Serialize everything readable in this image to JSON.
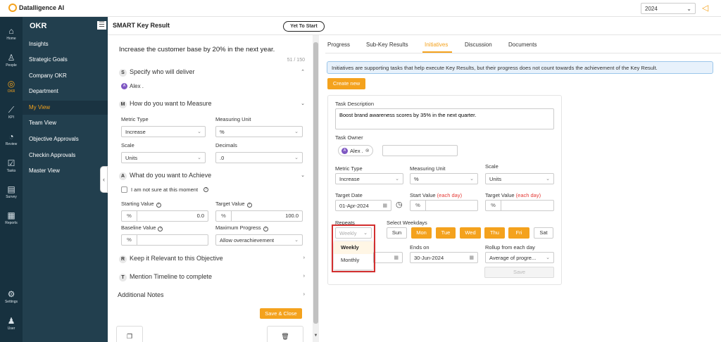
{
  "app": {
    "logo_text": "Datalligence AI"
  },
  "topbar": {
    "year": "2024"
  },
  "rail": [
    {
      "label": "Home",
      "icon": "home-icon"
    },
    {
      "label": "People",
      "icon": "people-icon"
    },
    {
      "label": "OKR",
      "icon": "okr-icon"
    },
    {
      "label": "KPI",
      "icon": "kpi-icon"
    },
    {
      "label": "Review",
      "icon": "review-icon"
    },
    {
      "label": "Tasks",
      "icon": "tasks-icon"
    },
    {
      "label": "Survey",
      "icon": "survey-icon"
    },
    {
      "label": "Reports",
      "icon": "reports-icon"
    },
    {
      "label": "Settings",
      "icon": "settings-icon"
    },
    {
      "label": "User",
      "icon": "user-icon"
    }
  ],
  "nav": {
    "title": "OKR",
    "items": [
      {
        "label": "Insights"
      },
      {
        "label": "Strategic Goals"
      },
      {
        "label": "Company OKR"
      },
      {
        "label": "Department"
      },
      {
        "label": "My View"
      },
      {
        "label": "Team View"
      },
      {
        "label": "Objective Approvals"
      },
      {
        "label": "Checkin Approvals"
      },
      {
        "label": "Master View"
      }
    ]
  },
  "kr": {
    "header_title": "SMART Key Result",
    "status": "Yet To Start",
    "title": "Increase the customer base by 20% in the next year.",
    "char_count": "51 / 150",
    "sections": {
      "specify": {
        "letter": "S",
        "title": "Specify who will deliver",
        "owner": "Alex .",
        "owner_initial": "A"
      },
      "measure": {
        "letter": "M",
        "title": "How do you want to Measure",
        "metric_type_label": "Metric Type",
        "metric_type": "Increase",
        "measuring_unit_label": "Measuring Unit",
        "measuring_unit": "%",
        "scale_label": "Scale",
        "scale": "Units",
        "decimals_label": "Decimals",
        "decimals": ".0"
      },
      "achieve": {
        "letter": "A",
        "title": "What do you want to Achieve",
        "not_sure": "I am not sure at this moment",
        "starting_label": "Starting Value",
        "starting_unit": "%",
        "starting": "0.0",
        "target_label": "Target Value",
        "target_unit": "%",
        "target": "100.0",
        "baseline_label": "Baseline Value",
        "baseline_unit": "%",
        "max_progress_label": "Maximum Progress",
        "max_progress": "Allow overachievement"
      },
      "relevant": {
        "letter": "R",
        "title": "Keep it Relevant to this Objective"
      },
      "timeline": {
        "letter": "T",
        "title": "Mention Timeline to complete"
      }
    },
    "notes_label": "Additional Notes",
    "save_close": "Save & Close"
  },
  "tabs": [
    {
      "label": "Progress"
    },
    {
      "label": "Sub-Key Results"
    },
    {
      "label": "Initiatives"
    },
    {
      "label": "Discussion"
    },
    {
      "label": "Documents"
    }
  ],
  "initiatives": {
    "info": "Initiatives are supporting tasks that help execute Key Results, but their progress does not count towards the achievement of the Key Result.",
    "create_new": "Create new",
    "task_desc_label": "Task Description",
    "task_desc": "Boost brand awareness scores by 35% in the next quarter.",
    "task_owner_label": "Task Owner",
    "task_owner": "Alex .",
    "task_owner_initial": "A",
    "metric_type_label": "Metric Type",
    "metric_type": "Increase",
    "measuring_unit_label": "Measuring Unit",
    "measuring_unit": "%",
    "scale_label": "Scale",
    "scale": "Units",
    "target_date_label": "Target Date",
    "target_date": "01-Apr-2024",
    "start_value_label": "Start Value",
    "each_day": "(each day)",
    "start_unit": "%",
    "target_value_label": "Target Value",
    "target_unit": "%",
    "repeats_label": "Repeats",
    "repeats_value": "Weekly",
    "weekdays_label": "Select Weekdays",
    "days": [
      {
        "label": "Sun",
        "on": false
      },
      {
        "label": "Mon",
        "on": true
      },
      {
        "label": "Tue",
        "on": true
      },
      {
        "label": "Wed",
        "on": true
      },
      {
        "label": "Thu",
        "on": true
      },
      {
        "label": "Fri",
        "on": true
      },
      {
        "label": "Sat",
        "on": false
      }
    ],
    "dropdown_options": [
      "Weekly",
      "Monthly"
    ],
    "ends_on_label": "Ends on",
    "ends_on": "30-Jun-2024",
    "rollup_label": "Rollup from each day",
    "rollup": "Average of progre...",
    "save": "Save"
  },
  "colors": {
    "accent": "#f4a21d",
    "rail": "#17313f",
    "nav": "#223f4e",
    "highlight": "#d32f2f"
  }
}
